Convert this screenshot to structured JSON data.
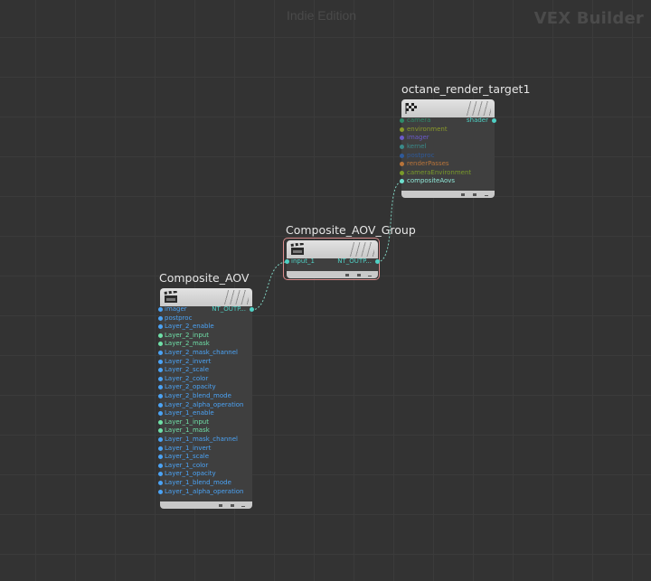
{
  "watermark": "Indie Edition",
  "context_title": "VEX Builder",
  "colors": {
    "background": "#333333",
    "wire": "#7fd1c0",
    "port_cyan": "#4fd1c5",
    "port_blue": "#4ba3f5",
    "port_olive": "#8a9a2a",
    "port_purple": "#6a5ac8",
    "port_teal": "#3a8a8a",
    "port_orange": "#b8743a",
    "selected_outline": "#d98a8a"
  },
  "nodes": {
    "octane": {
      "title": "octane_render_target1",
      "icon": "checkered-flag-icon",
      "output": "shader",
      "inputs": [
        "camera",
        "environment",
        "imager",
        "kernel",
        "postproc",
        "renderPasses",
        "cameraEnvironment",
        "compositeAovs"
      ]
    },
    "group": {
      "title": "Composite_AOV_Group",
      "icon": "clapperboard-icon",
      "input": "input_1",
      "output": "NT_OUTP..."
    },
    "aov": {
      "title": "Composite_AOV",
      "icon": "clapperboard-icon",
      "output": "NT_OUTP...",
      "inputs": [
        "imager",
        "postproc",
        "Layer_2_enable",
        "Layer_2_input",
        "Layer_2_mask",
        "Layer_2_mask_channel",
        "Layer_2_invert",
        "Layer_2_scale",
        "Layer_2_color",
        "Layer_2_opacity",
        "Layer_2_blend_mode",
        "Layer_2_alpha_operation",
        "Layer_1_enable",
        "Layer_1_input",
        "Layer_1_mask",
        "Layer_1_mask_channel",
        "Layer_1_invert",
        "Layer_1_scale",
        "Layer_1_color",
        "Layer_1_opacity",
        "Layer_1_blend_mode",
        "Layer_1_alpha_operation"
      ]
    }
  }
}
